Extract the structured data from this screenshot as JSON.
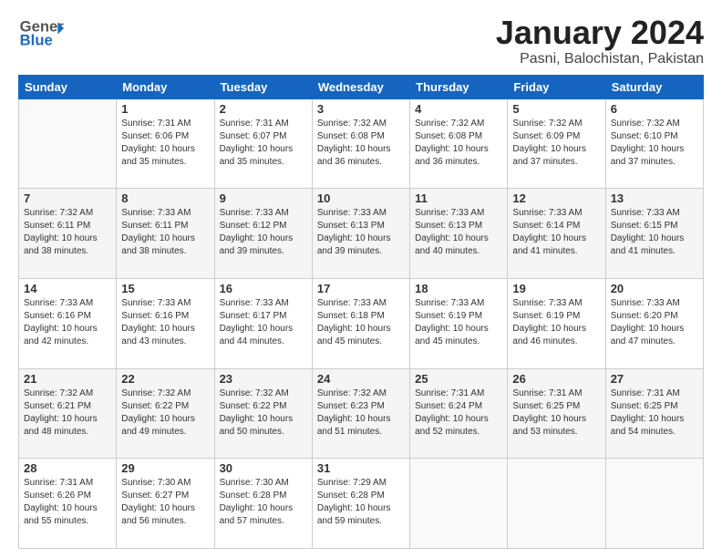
{
  "header": {
    "logo_general": "General",
    "logo_blue": "Blue",
    "main_title": "January 2024",
    "subtitle": "Pasni, Balochistan, Pakistan"
  },
  "days_of_week": [
    "Sunday",
    "Monday",
    "Tuesday",
    "Wednesday",
    "Thursday",
    "Friday",
    "Saturday"
  ],
  "weeks": [
    [
      {
        "day": "",
        "info": ""
      },
      {
        "day": "1",
        "info": "Sunrise: 7:31 AM\nSunset: 6:06 PM\nDaylight: 10 hours\nand 35 minutes."
      },
      {
        "day": "2",
        "info": "Sunrise: 7:31 AM\nSunset: 6:07 PM\nDaylight: 10 hours\nand 35 minutes."
      },
      {
        "day": "3",
        "info": "Sunrise: 7:32 AM\nSunset: 6:08 PM\nDaylight: 10 hours\nand 36 minutes."
      },
      {
        "day": "4",
        "info": "Sunrise: 7:32 AM\nSunset: 6:08 PM\nDaylight: 10 hours\nand 36 minutes."
      },
      {
        "day": "5",
        "info": "Sunrise: 7:32 AM\nSunset: 6:09 PM\nDaylight: 10 hours\nand 37 minutes."
      },
      {
        "day": "6",
        "info": "Sunrise: 7:32 AM\nSunset: 6:10 PM\nDaylight: 10 hours\nand 37 minutes."
      }
    ],
    [
      {
        "day": "7",
        "info": "Sunrise: 7:32 AM\nSunset: 6:11 PM\nDaylight: 10 hours\nand 38 minutes."
      },
      {
        "day": "8",
        "info": "Sunrise: 7:33 AM\nSunset: 6:11 PM\nDaylight: 10 hours\nand 38 minutes."
      },
      {
        "day": "9",
        "info": "Sunrise: 7:33 AM\nSunset: 6:12 PM\nDaylight: 10 hours\nand 39 minutes."
      },
      {
        "day": "10",
        "info": "Sunrise: 7:33 AM\nSunset: 6:13 PM\nDaylight: 10 hours\nand 39 minutes."
      },
      {
        "day": "11",
        "info": "Sunrise: 7:33 AM\nSunset: 6:13 PM\nDaylight: 10 hours\nand 40 minutes."
      },
      {
        "day": "12",
        "info": "Sunrise: 7:33 AM\nSunset: 6:14 PM\nDaylight: 10 hours\nand 41 minutes."
      },
      {
        "day": "13",
        "info": "Sunrise: 7:33 AM\nSunset: 6:15 PM\nDaylight: 10 hours\nand 41 minutes."
      }
    ],
    [
      {
        "day": "14",
        "info": "Sunrise: 7:33 AM\nSunset: 6:16 PM\nDaylight: 10 hours\nand 42 minutes."
      },
      {
        "day": "15",
        "info": "Sunrise: 7:33 AM\nSunset: 6:16 PM\nDaylight: 10 hours\nand 43 minutes."
      },
      {
        "day": "16",
        "info": "Sunrise: 7:33 AM\nSunset: 6:17 PM\nDaylight: 10 hours\nand 44 minutes."
      },
      {
        "day": "17",
        "info": "Sunrise: 7:33 AM\nSunset: 6:18 PM\nDaylight: 10 hours\nand 45 minutes."
      },
      {
        "day": "18",
        "info": "Sunrise: 7:33 AM\nSunset: 6:19 PM\nDaylight: 10 hours\nand 45 minutes."
      },
      {
        "day": "19",
        "info": "Sunrise: 7:33 AM\nSunset: 6:19 PM\nDaylight: 10 hours\nand 46 minutes."
      },
      {
        "day": "20",
        "info": "Sunrise: 7:33 AM\nSunset: 6:20 PM\nDaylight: 10 hours\nand 47 minutes."
      }
    ],
    [
      {
        "day": "21",
        "info": "Sunrise: 7:32 AM\nSunset: 6:21 PM\nDaylight: 10 hours\nand 48 minutes."
      },
      {
        "day": "22",
        "info": "Sunrise: 7:32 AM\nSunset: 6:22 PM\nDaylight: 10 hours\nand 49 minutes."
      },
      {
        "day": "23",
        "info": "Sunrise: 7:32 AM\nSunset: 6:22 PM\nDaylight: 10 hours\nand 50 minutes."
      },
      {
        "day": "24",
        "info": "Sunrise: 7:32 AM\nSunset: 6:23 PM\nDaylight: 10 hours\nand 51 minutes."
      },
      {
        "day": "25",
        "info": "Sunrise: 7:31 AM\nSunset: 6:24 PM\nDaylight: 10 hours\nand 52 minutes."
      },
      {
        "day": "26",
        "info": "Sunrise: 7:31 AM\nSunset: 6:25 PM\nDaylight: 10 hours\nand 53 minutes."
      },
      {
        "day": "27",
        "info": "Sunrise: 7:31 AM\nSunset: 6:25 PM\nDaylight: 10 hours\nand 54 minutes."
      }
    ],
    [
      {
        "day": "28",
        "info": "Sunrise: 7:31 AM\nSunset: 6:26 PM\nDaylight: 10 hours\nand 55 minutes."
      },
      {
        "day": "29",
        "info": "Sunrise: 7:30 AM\nSunset: 6:27 PM\nDaylight: 10 hours\nand 56 minutes."
      },
      {
        "day": "30",
        "info": "Sunrise: 7:30 AM\nSunset: 6:28 PM\nDaylight: 10 hours\nand 57 minutes."
      },
      {
        "day": "31",
        "info": "Sunrise: 7:29 AM\nSunset: 6:28 PM\nDaylight: 10 hours\nand 59 minutes."
      },
      {
        "day": "",
        "info": ""
      },
      {
        "day": "",
        "info": ""
      },
      {
        "day": "",
        "info": ""
      }
    ]
  ]
}
